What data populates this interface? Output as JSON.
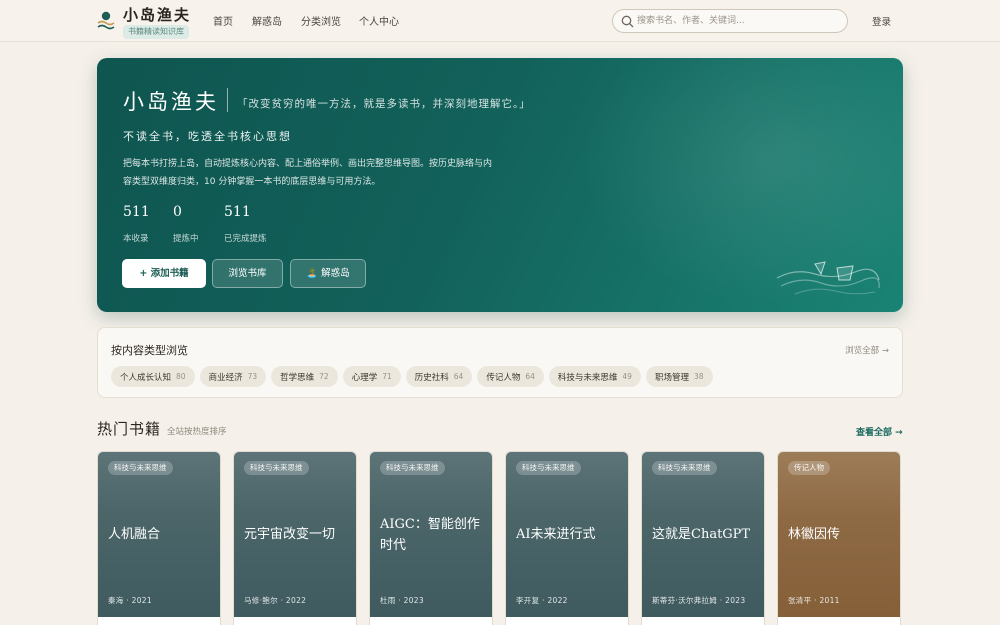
{
  "header": {
    "brand_name": "小岛渔夫",
    "brand_tag": "书籍精读知识库",
    "nav": [
      "首页",
      "解惑岛",
      "分类浏览",
      "个人中心"
    ],
    "search_placeholder": "搜索书名、作者、关键词...",
    "login": "登录"
  },
  "hero": {
    "title": "小岛渔夫",
    "quote": "「改变贫穷的唯一方法，就是多读书，并深刻地理解它。」",
    "subtitle": "不读全书，吃透全书核心思想",
    "desc_line1": "把每本书打捞上岛，自动提炼核心内容、配上通俗举例、画出完整思维导图。按历史脉络与内",
    "desc_line2": "容类型双维度归类，10 分钟掌握一本书的底层思维与可用方法。",
    "stats": [
      {
        "value": "511",
        "label": "本收录"
      },
      {
        "value": "0",
        "label": "提炼中"
      },
      {
        "value": "511",
        "label": "已完成提炼"
      }
    ],
    "buttons": {
      "add": "+ 添加书籍",
      "browse": "浏览书库",
      "island": "🏝️ 解惑岛"
    }
  },
  "categories": {
    "title": "按内容类型浏览",
    "view_all": "浏览全部 →",
    "items": [
      {
        "label": "个人成长认知",
        "count": "80"
      },
      {
        "label": "商业经济",
        "count": "73"
      },
      {
        "label": "哲学思维",
        "count": "72"
      },
      {
        "label": "心理学",
        "count": "71"
      },
      {
        "label": "历史社科",
        "count": "64"
      },
      {
        "label": "传记人物",
        "count": "64"
      },
      {
        "label": "科技与未来思维",
        "count": "49"
      },
      {
        "label": "职场管理",
        "count": "38"
      }
    ]
  },
  "hot_books": {
    "title": "热门书籍",
    "subtitle": "全站按热度排序",
    "view_all": "查看全部 →",
    "books": [
      {
        "tag": "科技与未来思维",
        "title": "人机融合",
        "meta": "秦海 · 2021"
      },
      {
        "tag": "科技与未来思维",
        "title": "元宇宙改变一切",
        "meta": "马修·鲍尔 · 2022"
      },
      {
        "tag": "科技与未来思维",
        "title": "AIGC：智能创作时代",
        "meta": "杜雨 · 2023"
      },
      {
        "tag": "科技与未来思维",
        "title": "AI未来进行式",
        "meta": "李开复 · 2022"
      },
      {
        "tag": "科技与未来思维",
        "title": "这就是ChatGPT",
        "meta": "斯蒂芬·沃尔弗拉姆 · 2023"
      },
      {
        "tag": "传记人物",
        "title": "林徽因传",
        "meta": "张清平 · 2011"
      }
    ]
  },
  "colors": {
    "hero_teal": "#12615a",
    "accent_link": "#1d6a5f",
    "cover_slate": "#4c6669",
    "cover_warm": "#8e6a44",
    "page_bg": "#f5f1ea"
  }
}
